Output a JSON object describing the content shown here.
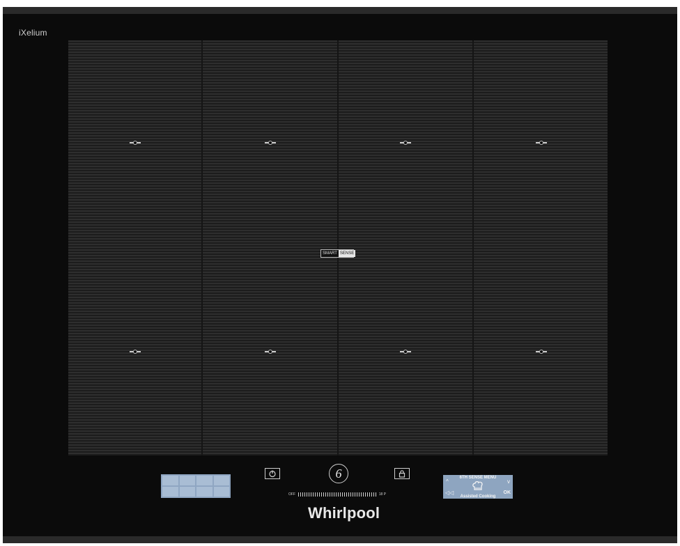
{
  "brand": {
    "series": "iXelium",
    "manufacturer": "Whirlpool"
  },
  "surface": {
    "smart_sense_left": "SMART",
    "smart_sense_right": "SENSE"
  },
  "controls": {
    "slider_min_label": "OFF",
    "slider_max_label": "18 P"
  },
  "display": {
    "title": "6TH SENSE MENU",
    "subtitle": "Assisted Cooking",
    "up_symbol": "^",
    "down_symbol": "v",
    "back_symbol": "◁◁",
    "ok_label": "OK",
    "center_icon": "chef-hat-icon"
  },
  "icons": {
    "power": "power-icon",
    "lock": "lock-icon",
    "sixth_sense": "sixth-sense-icon"
  },
  "sixth_sense_symbol": "6",
  "colors": {
    "hob_bg": "#0b0b0b",
    "surface_bg": "#2b2b2b",
    "display_blue": "#8ea5c0",
    "zone_grid_blue": "#a9bdd4",
    "text_light": "#e6e6e6"
  }
}
